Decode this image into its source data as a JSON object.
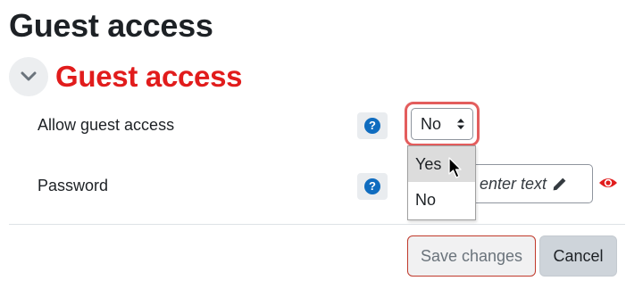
{
  "page": {
    "title": "Guest access"
  },
  "section": {
    "title": "Guest access",
    "collapse_icon": "chevron-down-icon"
  },
  "fields": {
    "allow_guest": {
      "label": "Allow guest access",
      "value": "No",
      "options": [
        "Yes",
        "No"
      ],
      "highlighted_option": "Yes"
    },
    "password": {
      "label": "Password",
      "placeholder": "enter text"
    }
  },
  "help_icon_text": "?",
  "actions": {
    "save_label": "Save changes",
    "cancel_label": "Cancel"
  },
  "colors": {
    "accent_red": "#e11c1c",
    "help_blue": "#0f6cbf",
    "focus_ring": "#e35d5d"
  }
}
